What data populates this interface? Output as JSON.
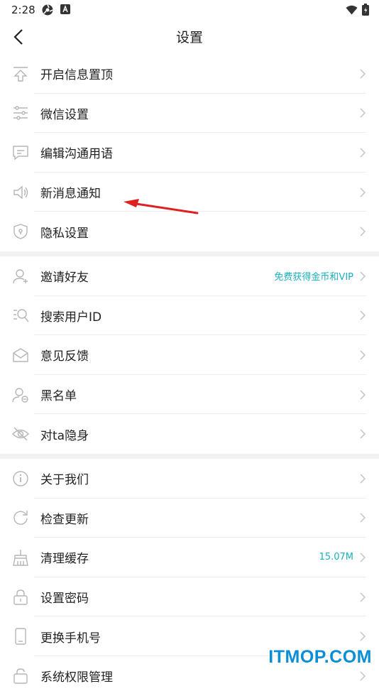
{
  "status_bar": {
    "time": "2:28"
  },
  "nav": {
    "title": "设置"
  },
  "groups": [
    {
      "items": [
        {
          "label": "开启信息置顶",
          "icon": "pin-top-icon"
        },
        {
          "label": "微信设置",
          "icon": "sliders-icon"
        },
        {
          "label": "编辑沟通用语",
          "icon": "message-icon"
        },
        {
          "label": "新消息通知",
          "icon": "speaker-icon"
        },
        {
          "label": "隐私设置",
          "icon": "shield-icon"
        }
      ]
    },
    {
      "items": [
        {
          "label": "邀请好友",
          "icon": "add-user-icon",
          "extra": "免费获得金币和VIP"
        },
        {
          "label": "搜索用户ID",
          "icon": "search-list-icon"
        },
        {
          "label": "意见反馈",
          "icon": "mail-icon"
        },
        {
          "label": "黑名单",
          "icon": "user-block-icon"
        },
        {
          "label": "对ta隐身",
          "icon": "eye-off-icon"
        }
      ]
    },
    {
      "items": [
        {
          "label": "关于我们",
          "icon": "info-icon"
        },
        {
          "label": "检查更新",
          "icon": "refresh-icon"
        },
        {
          "label": "清理缓存",
          "icon": "broom-icon",
          "extra": "15.07M"
        },
        {
          "label": "设置密码",
          "icon": "lock-icon"
        },
        {
          "label": "更换手机号",
          "icon": "phone-icon"
        },
        {
          "label": "系统权限管理",
          "icon": "permission-icon"
        }
      ]
    }
  ],
  "watermark": "ITMOP.COM",
  "colors": {
    "accent": "#19b0bd",
    "arrow": "#e02020",
    "watermark": "#0a8fd6",
    "icon": "#b5b5b5"
  }
}
